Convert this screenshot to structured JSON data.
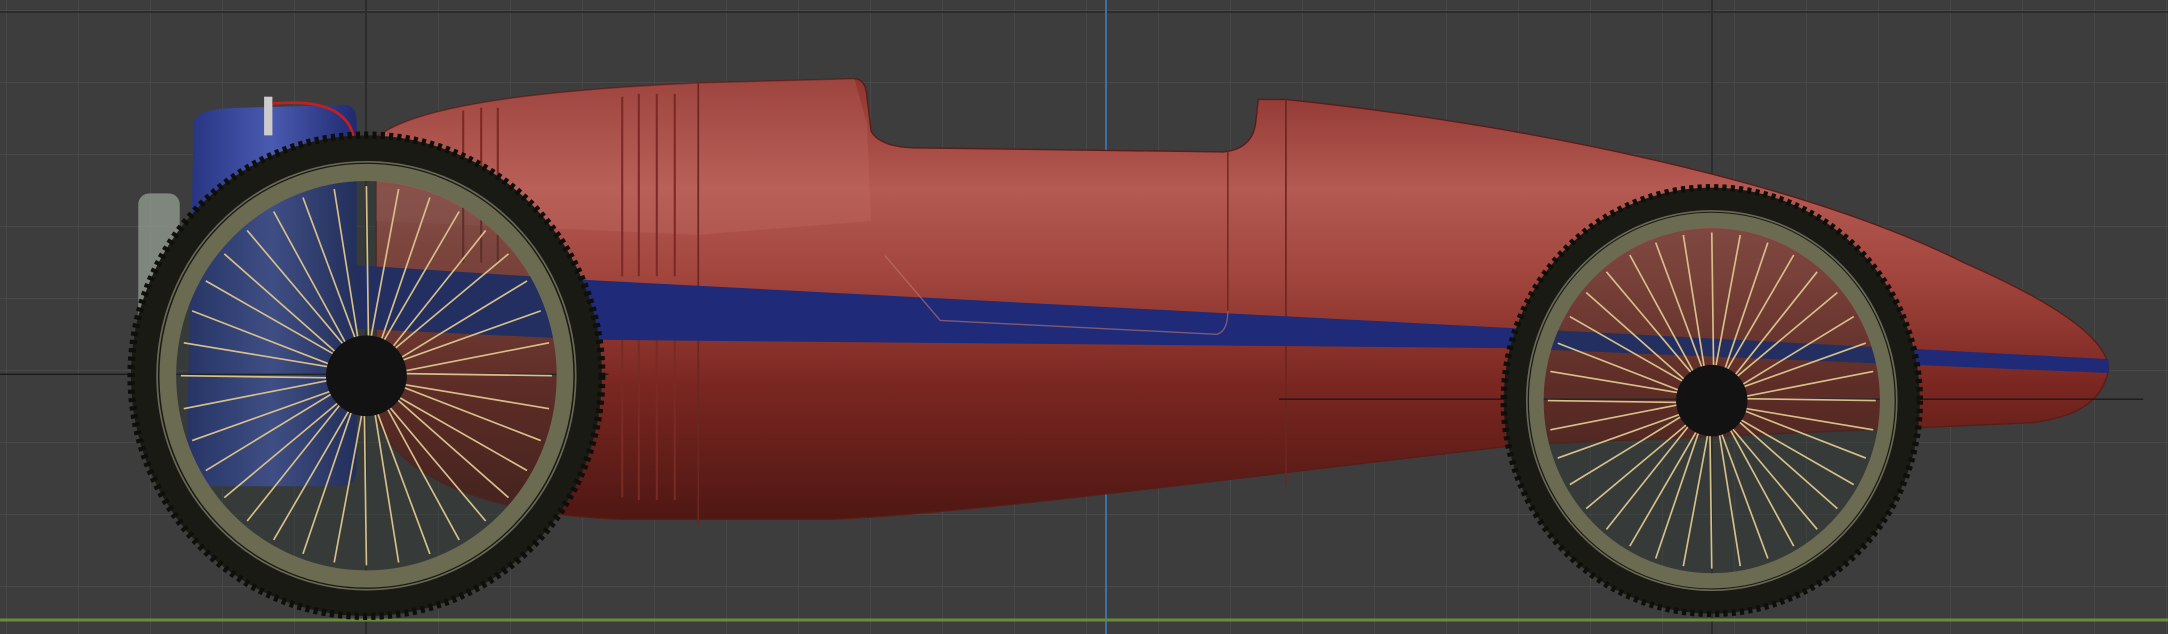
{
  "viewport": {
    "background_color": "#3d3d3d",
    "grid_color": "#4a4a4a",
    "grid_major_color": "#2e2e2e",
    "z_axis_color": "#3a6fa8",
    "x_axis_color": "#6b8a3a"
  },
  "model": {
    "body_color": "#9a3a33",
    "body_highlight": "#c0706a",
    "body_shadow": "#5e1a16",
    "stripe_color": "#1f2a78",
    "radiator_color": "#34449a",
    "tire_color": "#1a1a14",
    "rim_color": "#6b6b52",
    "spoke_color": "#d8c08a",
    "hub_color": "#121212",
    "spoke_count": 36
  }
}
